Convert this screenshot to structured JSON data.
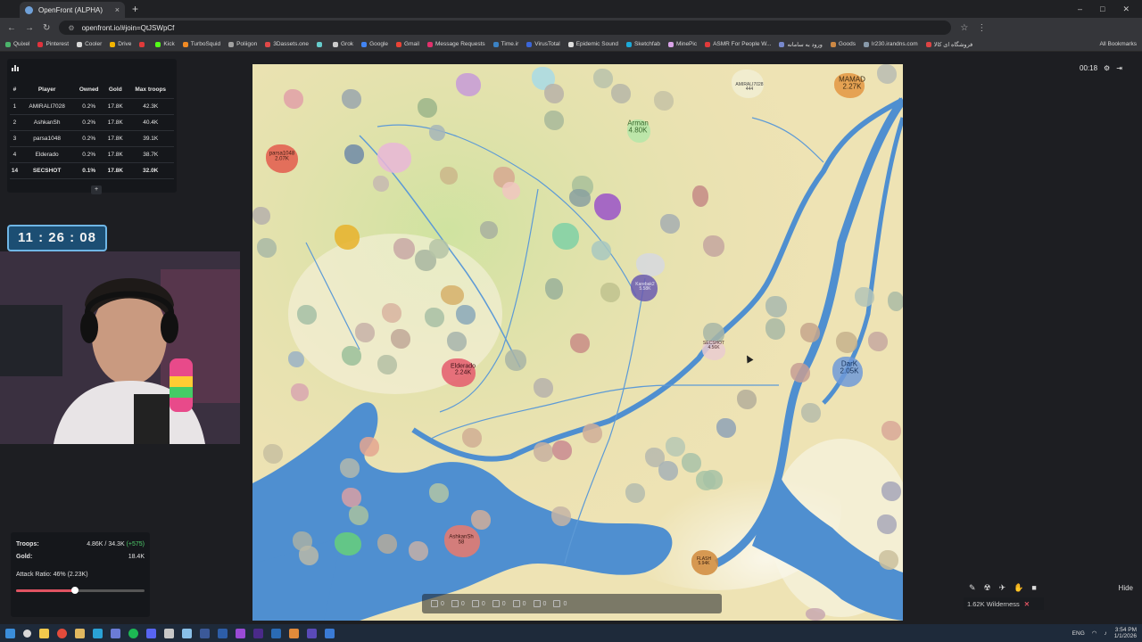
{
  "browser": {
    "tab_title": "OpenFront (ALPHA)",
    "tab_close": "×",
    "new_tab": "+",
    "url": "openfront.io/#join=QtJSWpCf",
    "win_min": "–",
    "win_max": "□",
    "win_close": "✕",
    "bookmarks": [
      {
        "label": "Quixel",
        "color": "#4bb36b"
      },
      {
        "label": "Pinterest",
        "color": "#e0323c"
      },
      {
        "label": "Cooler",
        "color": "#d9d9d9"
      },
      {
        "label": "Drive",
        "color": "#f4b400"
      },
      {
        "label": "",
        "color": "#e03a3a"
      },
      {
        "label": "Kick",
        "color": "#53fc18"
      },
      {
        "label": "TurboSquid",
        "color": "#f08a24"
      },
      {
        "label": "Poliigon",
        "color": "#a0a0a0"
      },
      {
        "label": "3Dassets.one",
        "color": "#e04848"
      },
      {
        "label": "",
        "color": "#6cc"
      },
      {
        "label": "Grok",
        "color": "#cccccc"
      },
      {
        "label": "Google",
        "color": "#4285f4"
      },
      {
        "label": "Gmail",
        "color": "#ea4335"
      },
      {
        "label": "Message Requests",
        "color": "#e1306c"
      },
      {
        "label": "Time.ir",
        "color": "#3b82c4"
      },
      {
        "label": "VirusTotal",
        "color": "#3b66d8"
      },
      {
        "label": "Epidemic Sound",
        "color": "#dddddd"
      },
      {
        "label": "Sketchfab",
        "color": "#1caad9"
      },
      {
        "label": "MinePic",
        "color": "#d9a3e8"
      },
      {
        "label": "ASMR For People W...",
        "color": "#e03a3a"
      },
      {
        "label": "ورود به سامانه",
        "color": "#7788cc"
      },
      {
        "label": "Goods",
        "color": "#cc8844"
      },
      {
        "label": "lr230.irandns.com",
        "color": "#8899aa"
      },
      {
        "label": "فروشگاه ای کالا",
        "color": "#dd4444"
      }
    ],
    "all_bookmarks": "All Bookmarks"
  },
  "leaderboard": {
    "headers": [
      "#",
      "Player",
      "Owned",
      "Gold",
      "Max troops"
    ],
    "rows": [
      {
        "rank": "1",
        "player": "AMIRALI7028",
        "owned": "0.2%",
        "gold": "17.8K",
        "troops": "42.3K"
      },
      {
        "rank": "2",
        "player": "AshkanSh",
        "owned": "0.2%",
        "gold": "17.8K",
        "troops": "40.4K"
      },
      {
        "rank": "3",
        "player": "parsa1048",
        "owned": "0.2%",
        "gold": "17.8K",
        "troops": "39.1K"
      },
      {
        "rank": "4",
        "player": "Elderado",
        "owned": "0.2%",
        "gold": "17.8K",
        "troops": "38.7K"
      },
      {
        "rank": "14",
        "player": "SECSHOT",
        "owned": "0.1%",
        "gold": "17.8K",
        "troops": "32.0K"
      }
    ],
    "expand": "+"
  },
  "clock": "11 : 26 : 08",
  "stats": {
    "troops_label": "Troops:",
    "troops_value": "4.86K / 34.3K",
    "troops_delta": "(+575)",
    "gold_label": "Gold:",
    "gold_value": "18.4K",
    "attack_label": "Attack Ratio: 46% (2.23K)",
    "attack_ratio": 0.46
  },
  "timer": "00:18",
  "map_labels": [
    {
      "name": "Arman",
      "value": "4.80K"
    },
    {
      "name": "MAMAD",
      "value": "2.27K"
    },
    {
      "name": "parsa1048",
      "value": "2.07K"
    },
    {
      "name": "Elderado",
      "value": "2.24K"
    },
    {
      "name": "DarK",
      "value": "2.05K"
    },
    {
      "name": "AshkanSh",
      "value": "58"
    },
    {
      "name": "SECSHOT",
      "value": "4.56K"
    },
    {
      "name": "AMIRALI7028",
      "value": "444"
    },
    {
      "name": "Karebak2",
      "value": "5.58K"
    },
    {
      "name": "FLASH",
      "value": "5.94K"
    }
  ],
  "build_bar": [
    "0",
    "0",
    "0",
    "0",
    "0",
    "0",
    "0"
  ],
  "bottom_right": {
    "hide": "Hide",
    "wilderness": "1.62K Wilderness",
    "close": "✕"
  },
  "taskbar": {
    "lang": "ENG",
    "time": "3:54 PM",
    "date": "1/1/2026"
  }
}
